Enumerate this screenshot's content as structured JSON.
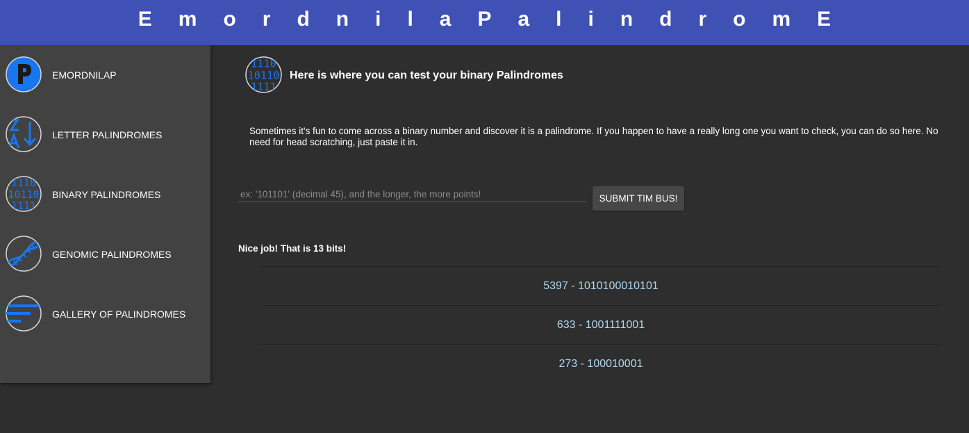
{
  "header": {
    "title": "EmordnilaPalindromE"
  },
  "sidebar": {
    "items": [
      {
        "label": "EMORDNILAP",
        "icon": "palindrome-p-icon"
      },
      {
        "label": "LETTER PALINDROMES",
        "icon": "letter-sort-icon"
      },
      {
        "label": "BINARY PALINDROMES",
        "icon": "binary-icon"
      },
      {
        "label": "GENOMIC PALINDROMES",
        "icon": "dna-icon"
      },
      {
        "label": "GALLERY OF PALINDROMES",
        "icon": "filter-lines-icon"
      }
    ]
  },
  "main": {
    "heading": "Here is where you can test your binary Palindromes",
    "description": "Sometimes it's fun to come across a binary number and discover it is a palindrome. If you happen to have a really long one you want to check, you can do so here. No need for head scratching, just paste it in.",
    "input": {
      "placeholder": "ex: '101101' (decimal 45), and the longer, the more points!",
      "value": ""
    },
    "submit_label": "SUBMIT TIM BUS!",
    "result": "Nice job! That is 13 bits!",
    "results": [
      "5397 - 1010100010101",
      "633 - 1001111001",
      "273 - 100010001"
    ]
  },
  "colors": {
    "header_bg": "#3f51b5",
    "page_bg": "#2e2e2e",
    "sidebar_bg": "#424242",
    "icon_blue": "#1976f2",
    "result_text": "#b3d6ec"
  }
}
